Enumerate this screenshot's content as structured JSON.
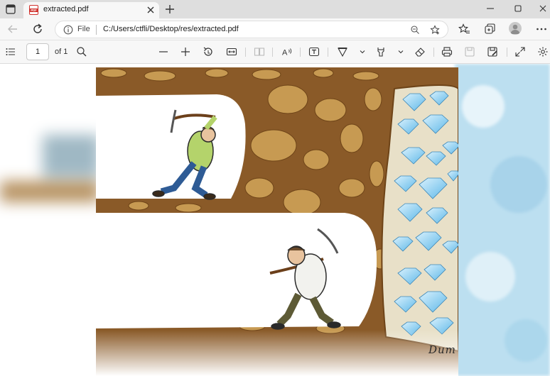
{
  "browser": {
    "tab": {
      "title": "extracted.pdf"
    },
    "address": {
      "scheme_label": "File",
      "url": "C:/Users/ctfli/Desktop/res/extracted.pdf"
    }
  },
  "pdf_toolbar": {
    "page_current": "1",
    "page_of": "of 1"
  },
  "document": {
    "signature": "Dum"
  },
  "colors": {
    "tab_strip": "#dedede",
    "toolbar": "#f7f7f7",
    "dirt": "#8a5a28",
    "rock": "#c79a52",
    "diamond": "#7ec8ef",
    "pdf_red": "#d0312d"
  },
  "icons": [
    "tab-actions-icon",
    "pdf-file-icon",
    "close-icon",
    "plus-icon",
    "minimize-icon",
    "maximize-icon",
    "back-arrow-icon",
    "refresh-icon",
    "info-icon",
    "zoom-icon",
    "favorite-add-icon",
    "favorites-icon",
    "collections-icon",
    "profile-icon",
    "more-icon",
    "contents-icon",
    "search-icon",
    "zoom-out-icon",
    "zoom-in-icon",
    "rotate-icon",
    "fit-page-icon",
    "page-view-icon",
    "read-aloud-icon",
    "text-icon",
    "draw-icon",
    "highlight-icon",
    "chevron-down-icon",
    "eraser-icon",
    "print-icon",
    "save-icon",
    "save-as-icon",
    "fullscreen-icon",
    "settings-icon"
  ]
}
